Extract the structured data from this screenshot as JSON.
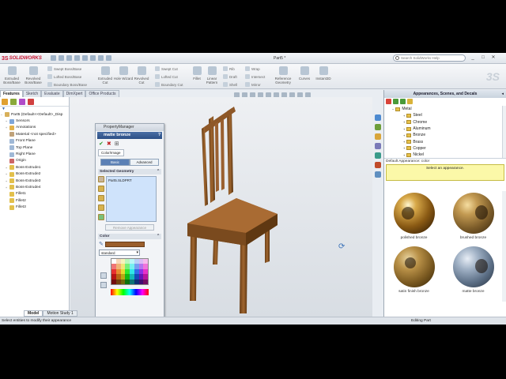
{
  "app": {
    "logo_ds": "3S",
    "logo_name": "SOLIDWORKS",
    "document_title": "Part5 *",
    "search_placeholder": "Search SolidWorks Help",
    "window_buttons": [
      "_",
      "□",
      "✕"
    ]
  },
  "command_manager": {
    "buttons": [
      {
        "label": "Extruded Boss/Base"
      },
      {
        "label": "Revolved Boss/Base"
      },
      {
        "label": "Extruded Cut"
      },
      {
        "label": "Hole Wizard"
      },
      {
        "label": "Revolved Cut"
      },
      {
        "label": "Fillet"
      },
      {
        "label": "Linear Pattern"
      },
      {
        "label": "Reference Geometry"
      },
      {
        "label": "Curves"
      },
      {
        "label": "Instant3D"
      }
    ],
    "small": [
      "Swept Boss/Base",
      "Lofted Boss/Base",
      "Boundary Boss/Base",
      "Swept Cut",
      "Lofted Cut",
      "Boundary Cut",
      "Rib",
      "Draft",
      "Shell",
      "Wrap",
      "Intersect",
      "Mirror"
    ]
  },
  "tabs": [
    "Features",
    "Sketch",
    "Evaluate",
    "DimXpert",
    "Office Products"
  ],
  "feature_tree": {
    "root": "Part5  (Default<<Default>_Disp",
    "items": [
      "Sensors",
      "Annotations",
      "Material <not specified>",
      "Front Plane",
      "Top Plane",
      "Right Plane",
      "Origin",
      "Boss-Extrude1",
      "Boss-Extrude2",
      "Boss-Extrude3",
      "Boss-Extrude4",
      "Fillet1",
      "Fillet2",
      "Fillet3"
    ],
    "bottom_tabs": [
      "Model",
      "Motion Study 1"
    ]
  },
  "property_manager": {
    "header": "PropertyManager",
    "title": "matte bronze",
    "help": "?",
    "tab": "Color/Image",
    "seg_basic": "Basic",
    "seg_advanced": "Advanced",
    "selected_geometry_label": "Selected Geometry",
    "selected_item": "Part5.SLDPRT",
    "remove_button": "Remove Appearance",
    "color_label": "Color",
    "color_value": "#9a5e2b",
    "standard_select": "standard"
  },
  "task_pane": {
    "title": "Appearances, Scenes, and Decals",
    "tree_root": "Metal",
    "tree_items": [
      "Steel",
      "Chrome",
      "Aluminum",
      "Bronze",
      "Brass",
      "Copper",
      "Nickel"
    ],
    "default_label": "Default Appearance: color",
    "tooltip": "Select an appearance.",
    "thumbnails": [
      "polished bronze",
      "brushed bronze",
      "satin finish bronze",
      "matte bronze"
    ]
  },
  "status": {
    "left": "Select entities to modify their appearance",
    "right": "Editing Part"
  }
}
